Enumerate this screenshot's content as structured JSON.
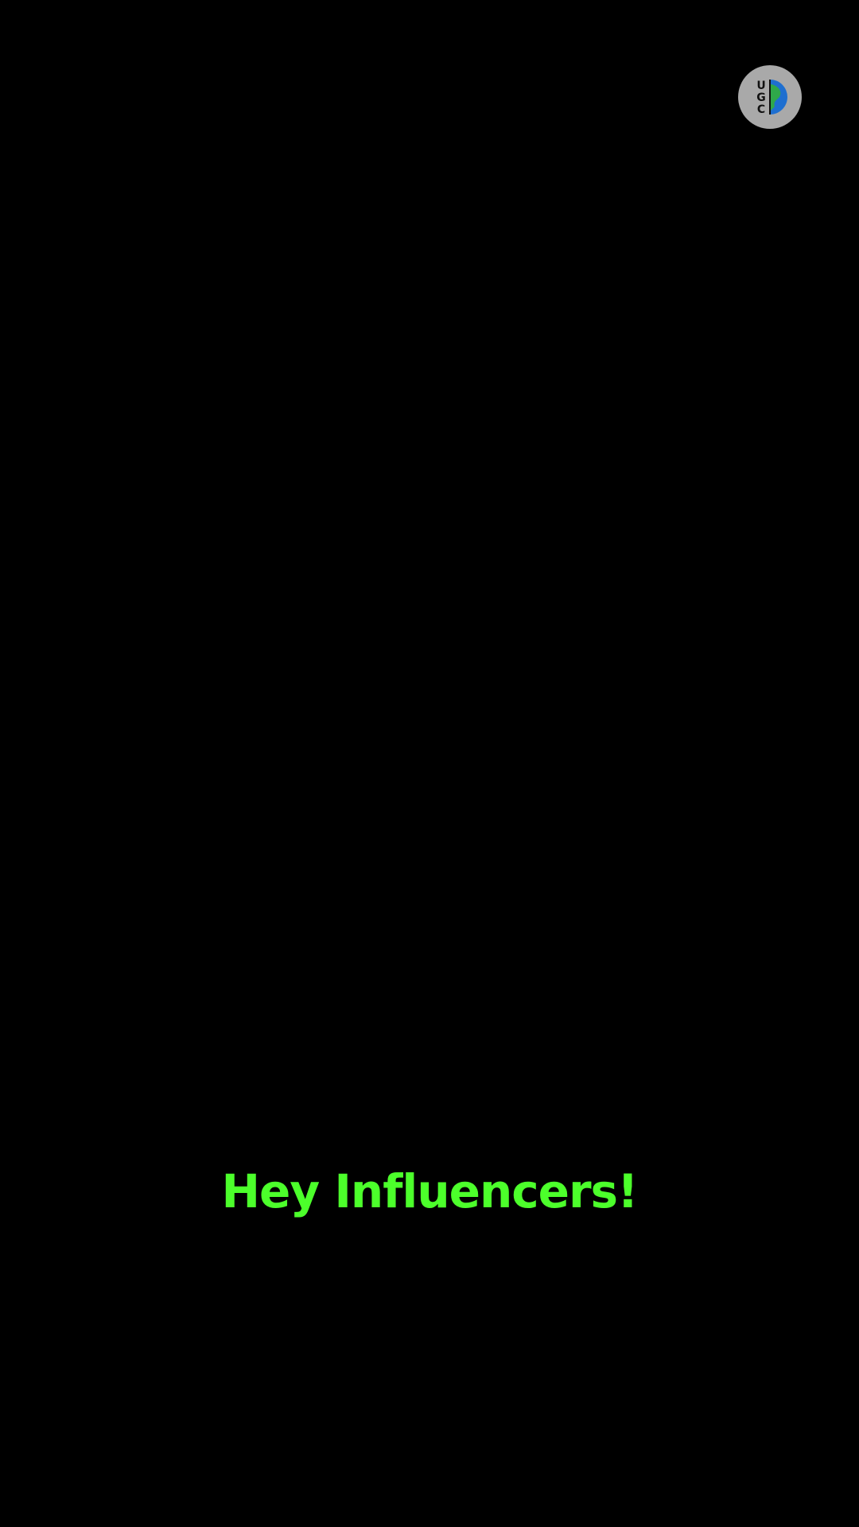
{
  "logo": {
    "text": "UGC",
    "icon": "ugc-globe-logo",
    "colors": {
      "badge": "#a9a9a9",
      "letters": "#111111",
      "globe_blue": "#1e6fd0",
      "globe_green": "#2fa84a"
    }
  },
  "caption": {
    "text": "Hey Influencers!",
    "color": "#4cff2b"
  },
  "background_color": "#000000"
}
